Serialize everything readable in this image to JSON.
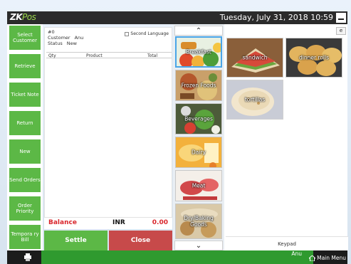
{
  "app": {
    "logo": "ZK",
    "logo_accent": "Pos",
    "datetime": "Tuesday, July 31, 2018 10:59"
  },
  "nav": {
    "items": [
      {
        "label": "Select Customer"
      },
      {
        "label": "Retrieve"
      },
      {
        "label": "Ticket Note"
      },
      {
        "label": "Return"
      },
      {
        "label": "New"
      },
      {
        "label": "Send Orders"
      },
      {
        "label": "Order Priority"
      },
      {
        "label": "Tempora ry Bill"
      }
    ]
  },
  "ticket": {
    "number": "#0",
    "customer_label": "Customer",
    "customer_value": "Anu",
    "status_label": "Status",
    "status_value": "New",
    "second_language_label": "Second Language",
    "columns": {
      "qty": "Qty",
      "product": "Product",
      "total": "Total"
    }
  },
  "balance": {
    "label": "Balance",
    "currency": "INR",
    "amount": "0.00"
  },
  "actions": {
    "settle": "Settle",
    "close": "Close"
  },
  "categories": [
    {
      "label": "Breakfast"
    },
    {
      "label": "Frozen Foods"
    },
    {
      "label": "Beverages"
    },
    {
      "label": "Dairy"
    },
    {
      "label": "Meat"
    },
    {
      "label": "Dry/Baking Goods"
    }
  ],
  "products": [
    {
      "label": "sandwich"
    },
    {
      "label": "dinner rolls"
    },
    {
      "label": "tortillas"
    }
  ],
  "keypad": "Keypad",
  "footer": {
    "user": "Anu",
    "main_menu": "Main Menu"
  },
  "icons": {
    "collapse": "e",
    "scroll_up": "▲",
    "scroll_down": "▼"
  }
}
